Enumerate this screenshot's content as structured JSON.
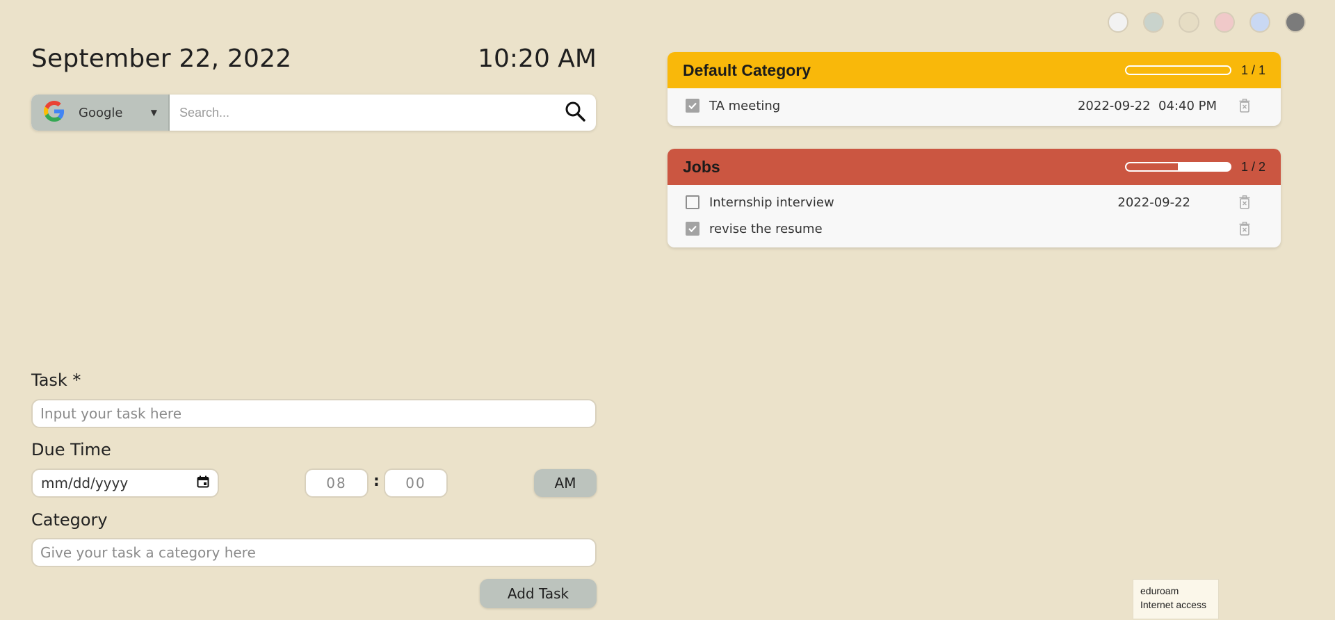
{
  "header": {
    "date": "September 22, 2022",
    "time": "10:20 AM"
  },
  "theme_swatches": [
    "#f2f2f2",
    "#c9d3cc",
    "#e6ddc4",
    "#f0c9c9",
    "#c9d8f3",
    "#7b7b7b"
  ],
  "search": {
    "engine": "Google",
    "placeholder": "Search..."
  },
  "form": {
    "task_label": "Task *",
    "task_placeholder": "Input your task here",
    "due_label": "Due Time",
    "date_placeholder": "mm/dd/yyyy",
    "hour": "08",
    "minute": "00",
    "ampm": "AM",
    "category_label": "Category",
    "category_placeholder": "Give your task a category here",
    "add_button": "Add Task"
  },
  "categories": [
    {
      "name": "Default Category",
      "color": "#f9b80a",
      "progress_fraction": 1.0,
      "count": "1 / 1",
      "tasks": [
        {
          "title": "TA meeting",
          "checked": true,
          "due": "2022-09-22  04:40 PM"
        }
      ]
    },
    {
      "name": "Jobs",
      "color": "#cb5641",
      "progress_fraction": 0.5,
      "count": "1 / 2",
      "tasks": [
        {
          "title": "Internship interview",
          "checked": false,
          "due": "2022-09-22"
        },
        {
          "title": "revise the resume",
          "checked": true,
          "due": ""
        }
      ]
    }
  ],
  "network_tooltip": {
    "line1": "eduroam",
    "line2": "Internet access"
  }
}
